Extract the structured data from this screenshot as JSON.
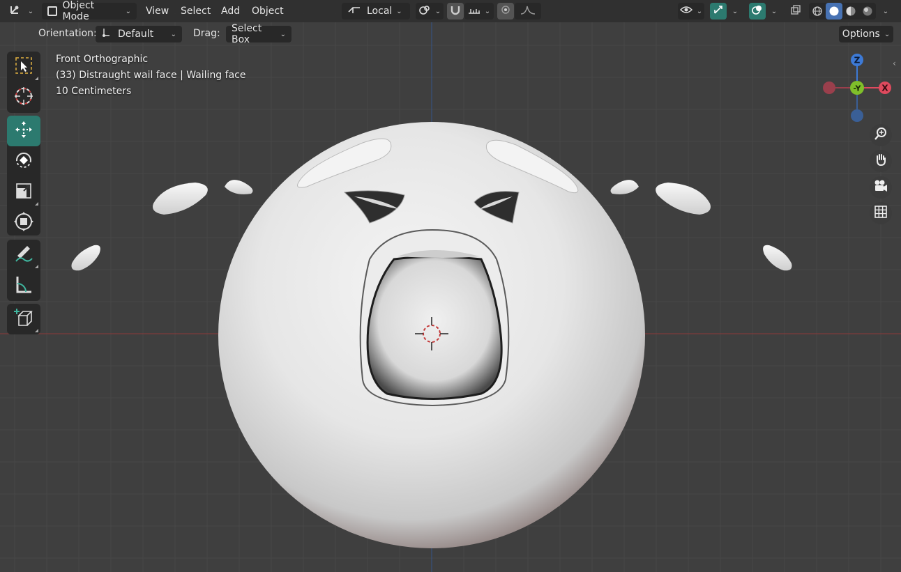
{
  "header": {
    "editor_type_icon": "axes-editor-icon",
    "mode": "Object Mode",
    "menus": [
      "View",
      "Select",
      "Add",
      "Object"
    ],
    "transform_orientation": "Local",
    "icons": {
      "mode": "object-mode-icon",
      "pivot": "pivot-point-icon",
      "snap": "snap-magnet-icon",
      "snap_target": "snap-increment-icon",
      "proportional": "proportional-edit-icon",
      "falloff": "falloff-curve-icon",
      "visibility": "eye-visibility-icon",
      "gizmo": "gizmo-toggle-icon",
      "overlays": "overlays-icon",
      "xray": "xray-toggle-icon",
      "shading_wire": "wireframe-shading-icon",
      "shading_solid": "solid-shading-icon",
      "shading_material": "material-shading-icon",
      "shading_rendered": "rendered-shading-icon"
    }
  },
  "tool_settings": {
    "orientation_label": "Orientation:",
    "orientation_value": "Default",
    "drag_label": "Drag:",
    "drag_value": "Select Box",
    "options_label": "Options"
  },
  "viewport_info": {
    "view_name": "Front Orthographic",
    "object_name": "(33) Distraught wail face | Wailing face",
    "scale": "10 Centimeters"
  },
  "toolbar": {
    "tools": [
      {
        "name": "select-box-tool",
        "icon": "select-box-icon",
        "active": false
      },
      {
        "name": "cursor-tool",
        "icon": "cursor-icon",
        "active": false
      },
      {
        "name": "move-tool",
        "icon": "move-icon",
        "active": true
      },
      {
        "name": "rotate-tool",
        "icon": "rotate-icon",
        "active": false
      },
      {
        "name": "scale-tool",
        "icon": "scale-icon",
        "active": false
      },
      {
        "name": "transform-tool",
        "icon": "transform-icon",
        "active": false
      },
      {
        "name": "annotate-tool",
        "icon": "annotate-icon",
        "active": false
      },
      {
        "name": "measure-tool",
        "icon": "measure-icon",
        "active": false
      },
      {
        "name": "add-cube-tool",
        "icon": "add-cube-icon",
        "active": false
      }
    ]
  },
  "gizmo": {
    "z_label": "Z",
    "y_label": "-Y",
    "x_label": "X",
    "colors": {
      "x": "#e04a5e",
      "y": "#7fbf2a",
      "z": "#3d7ad6",
      "neg_x": "#9a3f4c",
      "neg_z": "#3a5f96"
    }
  },
  "navigation": [
    "zoom-icon",
    "hand-pan-icon",
    "camera-view-icon",
    "grid-ortho-icon"
  ],
  "colors": {
    "accent_teal": "#2c7a6f",
    "accent_blue": "#4772b3",
    "header_bg": "#303030",
    "viewport_bg": "#3f3f3f",
    "x_axis_line": "#8c3a3a",
    "z_axis_line": "#34558a"
  }
}
